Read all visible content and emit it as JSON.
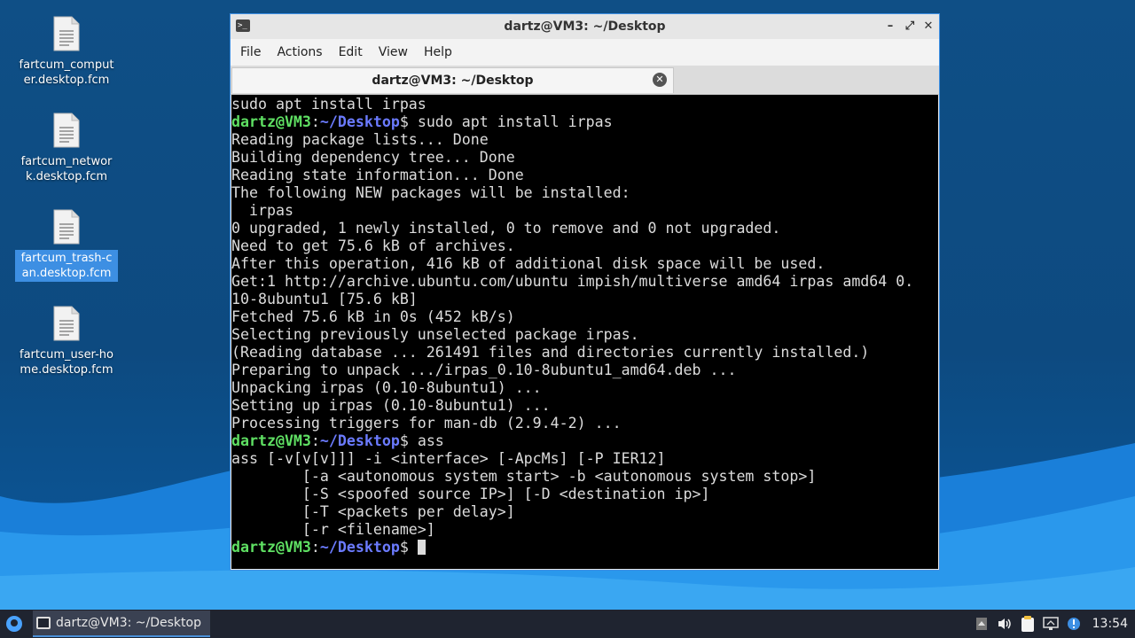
{
  "desktop": {
    "icons": [
      {
        "label": "fartcum_computer.desktop.fcm",
        "selected": false
      },
      {
        "label": "fartcum_network.desktop.fcm",
        "selected": false
      },
      {
        "label": "fartcum_trash-can.desktop.fcm",
        "selected": true
      },
      {
        "label": "fartcum_user-home.desktop.fcm",
        "selected": false
      }
    ]
  },
  "window": {
    "title": "dartz@VM3: ~/Desktop",
    "icon": "terminal-icon",
    "controls": {
      "minimize": "–",
      "maximize": "⤢",
      "close": "✕"
    },
    "menu": [
      "File",
      "Actions",
      "Edit",
      "View",
      "Help"
    ],
    "tab": {
      "label": "dartz@VM3: ~/Desktop",
      "close": "✕"
    }
  },
  "terminal": {
    "prompt": {
      "user": "dartz@VM3",
      "colon": ":",
      "path": "~/Desktop",
      "dollar": "$ "
    },
    "colors": {
      "user": "#5fe063",
      "path": "#6b7bff",
      "text": "#dcdcdc",
      "background": "#000000"
    },
    "lines": [
      {
        "text": "sudo apt install irpas"
      },
      {
        "prompt": true,
        "text": "sudo apt install irpas"
      },
      {
        "text": "Reading package lists... Done"
      },
      {
        "text": "Building dependency tree... Done"
      },
      {
        "text": "Reading state information... Done"
      },
      {
        "text": "The following NEW packages will be installed:"
      },
      {
        "text": "  irpas"
      },
      {
        "text": "0 upgraded, 1 newly installed, 0 to remove and 0 not upgraded."
      },
      {
        "text": "Need to get 75.6 kB of archives."
      },
      {
        "text": "After this operation, 416 kB of additional disk space will be used."
      },
      {
        "text": "Get:1 http://archive.ubuntu.com/ubuntu impish/multiverse amd64 irpas amd64 0."
      },
      {
        "text": "10-8ubuntu1 [75.6 kB]"
      },
      {
        "text": "Fetched 75.6 kB in 0s (452 kB/s)"
      },
      {
        "text": "Selecting previously unselected package irpas."
      },
      {
        "text": "(Reading database ... 261491 files and directories currently installed.)"
      },
      {
        "text": "Preparing to unpack .../irpas_0.10-8ubuntu1_amd64.deb ..."
      },
      {
        "text": "Unpacking irpas (0.10-8ubuntu1) ..."
      },
      {
        "text": "Setting up irpas (0.10-8ubuntu1) ..."
      },
      {
        "text": "Processing triggers for man-db (2.9.4-2) ..."
      },
      {
        "prompt": true,
        "text": "ass"
      },
      {
        "text": "ass [-v[v[v]]] -i <interface> [-ApcMs] [-P IER12]"
      },
      {
        "text": "        [-a <autonomous system start> -b <autonomous system stop>]"
      },
      {
        "text": "        [-S <spoofed source IP>] [-D <destination ip>]"
      },
      {
        "text": "        [-T <packets per delay>]"
      },
      {
        "text": "        [-r <filename>]"
      },
      {
        "prompt": true,
        "text": "",
        "cursor": true
      }
    ]
  },
  "taskbar": {
    "start_icon": "start-menu-icon",
    "task_label": "dartz@VM3: ~/Desktop",
    "tray_icons": [
      "tray-up-icon",
      "volume-icon",
      "clipboard-icon",
      "network-icon",
      "update-notification-icon"
    ],
    "clock": "13:54"
  }
}
